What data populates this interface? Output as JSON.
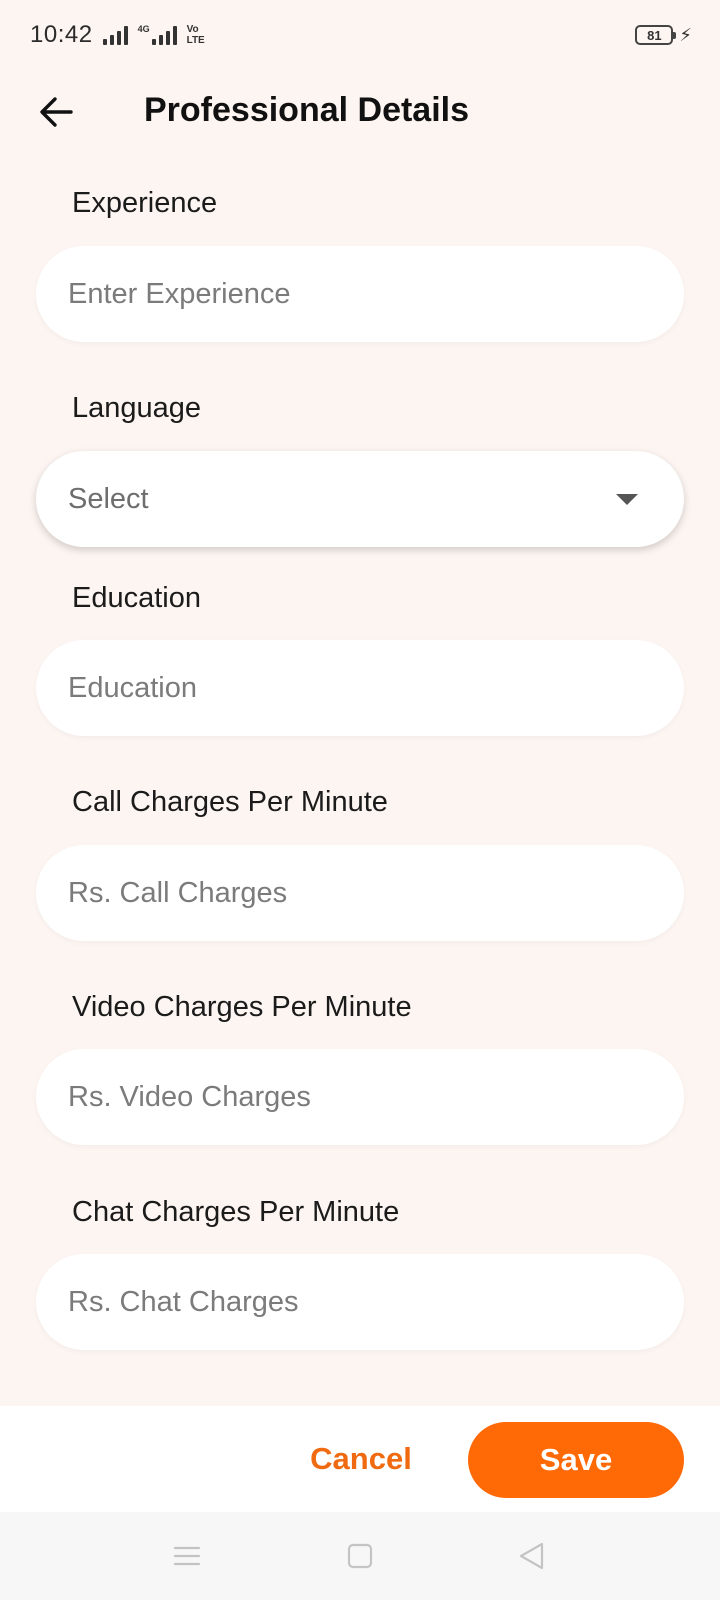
{
  "status_bar": {
    "time": "10:42",
    "network_tag": "4G",
    "volte_line1": "Vo",
    "volte_line2": "LTE",
    "battery": "81"
  },
  "header": {
    "title": "Professional Details"
  },
  "form": {
    "experience": {
      "label": "Experience",
      "placeholder": "Enter Experience",
      "value": ""
    },
    "language": {
      "label": "Language",
      "selected": "Select"
    },
    "education": {
      "label": "Education",
      "placeholder": "Education",
      "value": ""
    },
    "call_charges": {
      "label": "Call Charges Per Minute",
      "placeholder": "Rs. Call Charges",
      "value": ""
    },
    "video_charges": {
      "label": "Video Charges Per Minute",
      "placeholder": "Rs. Video Charges",
      "value": ""
    },
    "chat_charges": {
      "label": "Chat Charges Per Minute",
      "placeholder": "Rs. Chat Charges",
      "value": ""
    }
  },
  "actions": {
    "cancel_label": "Cancel",
    "save_label": "Save"
  },
  "colors": {
    "background": "#fdf5f1",
    "accent": "#ff6a07",
    "cancel_text": "#f06a12"
  },
  "icons": {
    "back": "arrow-left-icon",
    "dropdown": "caret-down-icon",
    "nav_menu": "menu-icon",
    "nav_home": "square-icon",
    "nav_back": "triangle-back-icon"
  }
}
